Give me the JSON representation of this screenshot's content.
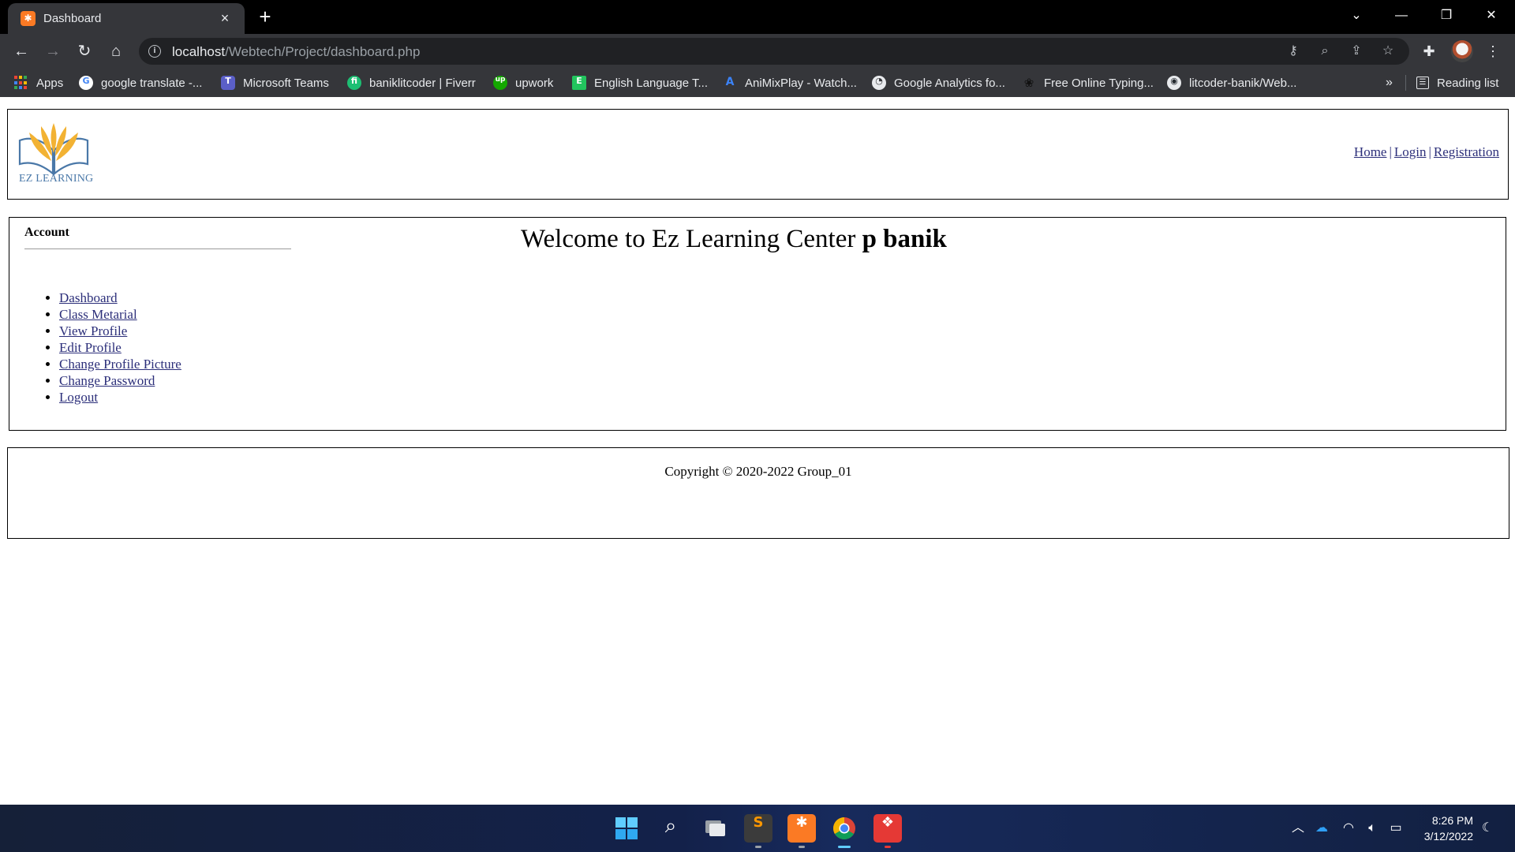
{
  "browser": {
    "tab_title": "Dashboard",
    "tab_close": "×",
    "new_tab": "+",
    "url_host": "localhost",
    "url_path": "/Webtech/Project/dashboard.php",
    "bookmarks": [
      {
        "label": "Apps",
        "icon": "apps-grid-icon"
      },
      {
        "label": "google translate -...",
        "icon": "google-icon",
        "color": "#4285f4",
        "glyph": "G"
      },
      {
        "label": "Microsoft Teams",
        "icon": "teams-icon",
        "color": "#5b5fc7",
        "glyph": "T"
      },
      {
        "label": "baniklitcoder | Fiverr",
        "icon": "fiverr-icon",
        "color": "#1dbf73",
        "glyph": "fi"
      },
      {
        "label": "upwork",
        "icon": "upwork-icon",
        "color": "#14a800",
        "glyph": "up"
      },
      {
        "label": "English Language T...",
        "icon": "english-language-icon",
        "color": "#22c55e",
        "glyph": "E"
      },
      {
        "label": "AniMixPlay - Watch...",
        "icon": "animixplay-icon",
        "color": "#3b82f6",
        "glyph": "A"
      },
      {
        "label": "Google Analytics fo...",
        "icon": "analytics-icon",
        "color": "#5f6368",
        "glyph": "◔"
      },
      {
        "label": "Free Online Typing...",
        "icon": "typing-paw-icon",
        "color": "#111111",
        "glyph": "❀"
      },
      {
        "label": "litcoder-banik/Web...",
        "icon": "github-icon",
        "color": "#24292f",
        "glyph": "◉"
      }
    ],
    "overflow": "»",
    "reading_list": "Reading list"
  },
  "header": {
    "logo_text": "EZ LEARNING",
    "nav": [
      {
        "label": "Home"
      },
      {
        "label": "Login"
      },
      {
        "label": "Registration"
      }
    ],
    "nav_separator": "|"
  },
  "sidebar": {
    "title": "Account",
    "items": [
      {
        "label": "Dashboard"
      },
      {
        "label": "Class Metarial"
      },
      {
        "label": "View Profile"
      },
      {
        "label": "Edit Profile"
      },
      {
        "label": "Change Profile Picture"
      },
      {
        "label": "Change Password"
      },
      {
        "label": "Logout"
      }
    ]
  },
  "main": {
    "welcome_prefix": "Welcome to Ez Learning Center",
    "username": "p banik"
  },
  "footer": {
    "copyright": "Copyright © 2020-2022 Group_01"
  },
  "taskbar": {
    "time": "8:26 PM",
    "date": "3/12/2022"
  },
  "colors": {
    "link": "#2c2f7a",
    "chrome_dark": "#35363a",
    "logo_gold": "#f2b233",
    "logo_blue": "#4a78a8"
  }
}
